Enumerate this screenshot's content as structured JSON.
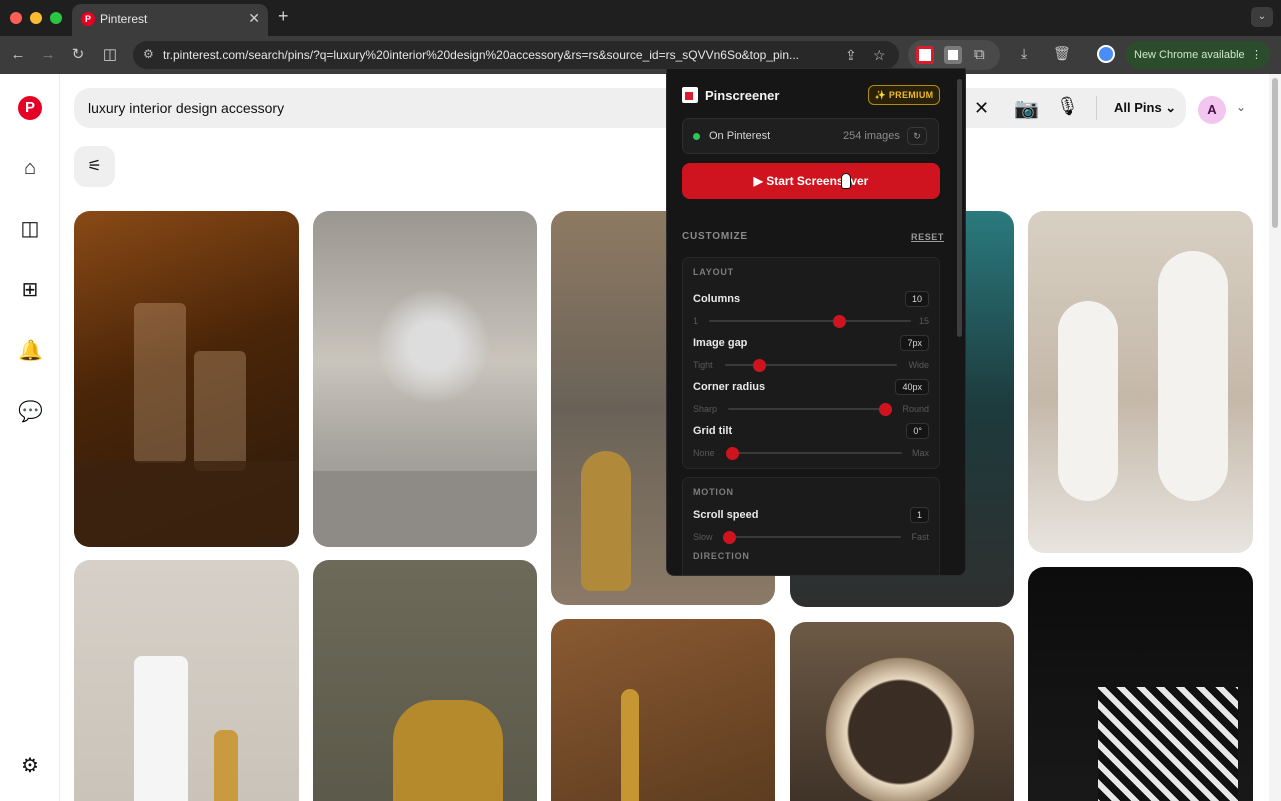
{
  "browser": {
    "tab_title": "Pinterest",
    "tab_close": "✕",
    "new_tab": "+",
    "tab_menu": "⌄",
    "url": "tr.pinterest.com/search/pins/?q=luxury%20interior%20design%20accessory&rs=rs&source_id=rs_sQVVn6So&top_pin...",
    "new_chrome": "New Chrome available",
    "menu_dots": "⋮"
  },
  "pinterest": {
    "search_query": "luxury interior design accessory",
    "filter": "All Pins",
    "avatar_letter": "A"
  },
  "popup": {
    "title": "Pinscreener",
    "premium": "✨ PREMIUM",
    "status": "On Pinterest",
    "image_count": "254 images",
    "refresh": "↻",
    "start": "▶ Start Screensaver",
    "customize": "CUSTOMIZE",
    "reset": "RESET",
    "layout": {
      "title": "LAYOUT",
      "columns": {
        "label": "Columns",
        "value": "10",
        "min": "1",
        "max": "15",
        "fraction": 0.643
      },
      "gap": {
        "label": "Image gap",
        "value": "7px",
        "min": "Tight",
        "max": "Wide",
        "fraction": 0.2
      },
      "radius": {
        "label": "Corner radius",
        "value": "40px",
        "min": "Sharp",
        "max": "Round",
        "fraction": 1.0
      },
      "tilt": {
        "label": "Grid tilt",
        "value": "0°",
        "min": "None",
        "max": "Max",
        "fraction": 0.0
      }
    },
    "motion": {
      "title": "MOTION",
      "speed": {
        "label": "Scroll speed",
        "value": "1",
        "min": "Slow",
        "max": "Fast",
        "fraction": 0.0
      },
      "direction": "DIRECTION"
    }
  }
}
